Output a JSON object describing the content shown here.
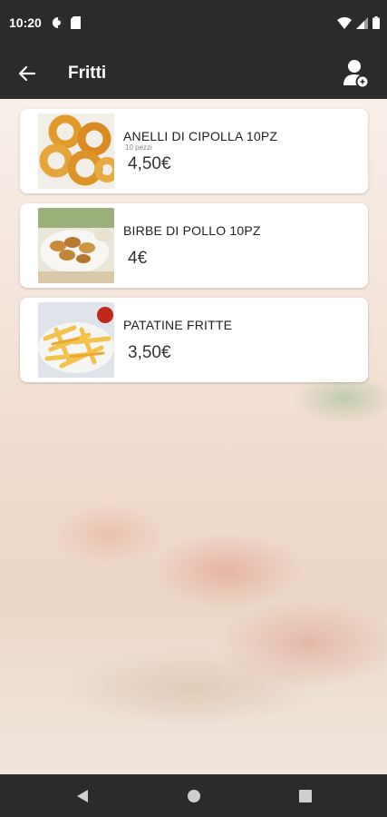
{
  "status_bar": {
    "time": "10:20"
  },
  "app_bar": {
    "title": "Fritti"
  },
  "items": [
    {
      "name": "ANELLI DI CIPOLLA 10PZ",
      "subtitle": "10 pezzi",
      "price": "4,50€",
      "image": "onion-rings"
    },
    {
      "name": "BIRBE DI POLLO 10PZ",
      "subtitle": "",
      "price": "4€",
      "image": "chicken-nuggets"
    },
    {
      "name": "PATATINE FRITTE",
      "subtitle": "",
      "price": "3,50€",
      "image": "french-fries"
    }
  ],
  "colors": {
    "bar": "#2b2b2b",
    "card": "#ffffff",
    "text": "#222222"
  }
}
